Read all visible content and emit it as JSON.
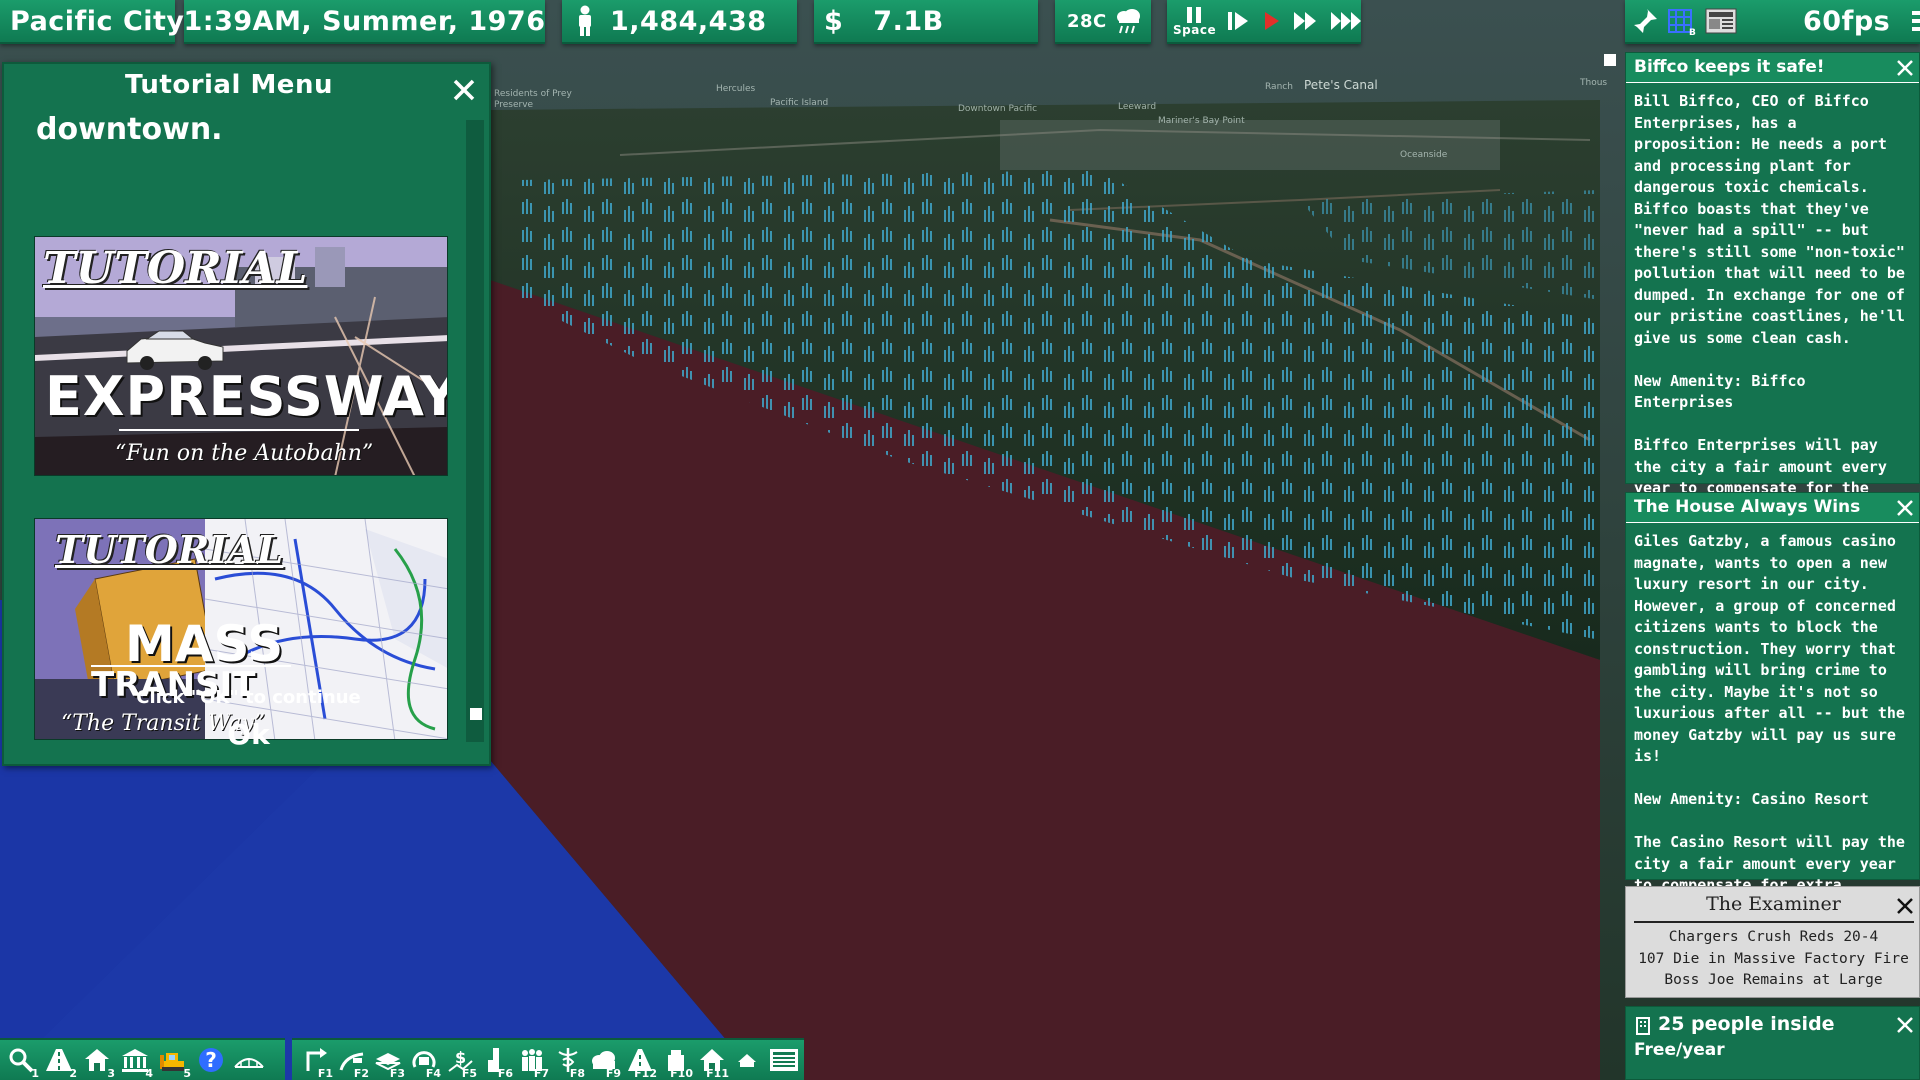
{
  "topbar": {
    "city_name": "Pacific City",
    "datetime": "1:39AM,  Summer,  1976",
    "population": "1,484,438",
    "money_symbol": "$",
    "money": "7.1B",
    "temperature": "28C",
    "pause_key": "Space",
    "fps": "60fps"
  },
  "map_labels": [
    "Hercules",
    "Pacific Island",
    "Pete's Canal",
    "Ranch",
    "Thous",
    "Downtown Pacific",
    "Mariner's Bay Point",
    "Leeward",
    "Oceanside",
    "Residents of Prey",
    "Preserve"
  ],
  "tutorial": {
    "title": "Tutorial  Menu",
    "top_text": "downtown.",
    "cards": [
      {
        "tag": "TUTORIAL",
        "main": "EXPRESSWAYS",
        "sub": "“Fun on the Autobahn”"
      },
      {
        "tag": "TUTORIAL",
        "main": "MASS",
        "main2": "TRANSIT",
        "sub": "“The Transit Way”"
      }
    ],
    "continue_text": "Click \"OK\" to continue",
    "ok_label": "Ok"
  },
  "news": [
    {
      "title": "Biffco keeps it safe!",
      "body": "Bill Biffco, CEO of Biffco Enterprises, has a proposition: He needs a port and processing plant for dangerous toxic chemicals. Biffco boasts that they've \"never had a spill\" -- but there's still some \"non-toxic\" pollution that will need to be dumped. In exchange for one of our pristine coastlines, he'll give us some clean cash.\n\nNew Amenity: Biffco Enterprises\n\nBiffco Enterprises will pay the city a fair amount every year to compensate for the inevitable pollution from the plant."
    },
    {
      "title": "The House Always Wins",
      "body": "Giles Gatzby, a famous casino magnate, wants to open a new luxury resort in our city. However, a group of concerned citizens wants to block the construction. They worry that gambling will bring crime to the city. Maybe it's not so luxurious after all -- but the money Gatzby will pay us sure is!\n\nNew Amenity: Casino Resort\n\nThe Casino Resort will pay the city a fair amount every year to compensate for extra policing."
    }
  ],
  "examiner": {
    "title": "The  Examiner",
    "headlines": [
      "Chargers  Crush  Reds  20-4",
      "107  Die  in  Massive  Factory  Fire",
      "Boss  Joe  Remains  at  Large"
    ]
  },
  "info_panel": {
    "people": "25  people  inside",
    "cost": "Free/year"
  },
  "toolbar_left": [
    {
      "icon": "query-icon",
      "key": "1"
    },
    {
      "icon": "road-icon",
      "key": "2"
    },
    {
      "icon": "zone-icon",
      "key": "3"
    },
    {
      "icon": "government-icon",
      "key": "4"
    },
    {
      "icon": "bulldozer-icon",
      "key": "5"
    },
    {
      "icon": "help-icon",
      "key": ""
    },
    {
      "icon": "budget-icon",
      "key": ""
    }
  ],
  "toolbar_right": [
    {
      "icon": "routes-view-icon",
      "key": "F1"
    },
    {
      "icon": "traffic-view-icon",
      "key": "F2"
    },
    {
      "icon": "zones-view-icon",
      "key": "F3"
    },
    {
      "icon": "transit-view-icon",
      "key": "F4"
    },
    {
      "icon": "money-view-icon",
      "key": "F5"
    },
    {
      "icon": "density-view-icon",
      "key": "F6"
    },
    {
      "icon": "population-view-icon",
      "key": "F7"
    },
    {
      "icon": "health-view-icon",
      "key": "F8"
    },
    {
      "icon": "pollution-view-icon",
      "key": "F9"
    },
    {
      "icon": "land-value-view-icon",
      "key": "F12"
    },
    {
      "icon": "education-view-icon",
      "key": "F10"
    },
    {
      "icon": "housing-view-icon",
      "key": "F11"
    },
    {
      "icon": "hide-ui-icon",
      "key": ""
    },
    {
      "icon": "newspaper-icon",
      "key": ""
    }
  ],
  "colors": {
    "panel": "#14734f",
    "panel_header": "#188c5e",
    "ocean": "#1b36a6",
    "sand": "#4a1d26",
    "land": "#1b2c1e",
    "trees": "#3fa5c8"
  }
}
